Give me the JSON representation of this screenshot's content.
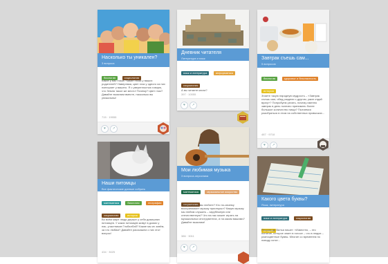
{
  "cards": [
    {
      "title": "Насколько ты уникален?",
      "subtitle": "3 вопроса",
      "tags": [
        {
          "label": "биология",
          "color": "#5aa343"
        },
        {
          "label": "социология",
          "color": "#7a4a1e"
        }
      ],
      "body": "Какие у вас глаза? Какие глаза у ваших родителей? Наверняка, цвет глаз у одного из них повторяет у вашего. Я с уверенностью говорю, что Земля такое же место! Почему? Цвет глаз? Давайте выясним вместе, насколько вы уникальны!",
      "meta": "715 · 19955"
    },
    {
      "title": "Дневник читателя",
      "subtitle": "Литература и язык",
      "tags": [
        {
          "label": "язык и литература",
          "color": "#2f6f7a"
        },
        {
          "label": "информатика",
          "color": "#e3a23a"
        },
        {
          "label": "социология",
          "color": "#7a4a1e"
        }
      ],
      "body": "А вы читаете книги?",
      "meta": "397 · 10055"
    },
    {
      "title": "Завтрак съешь сам...",
      "subtitle": "5 вопросов",
      "tags": [
        {
          "label": "биология",
          "color": "#5aa343"
        },
        {
          "label": "здоровье и безопасность",
          "color": "#e0832c"
        },
        {
          "label": "история",
          "color": "#e6c21f"
        }
      ],
      "body": "Знаете такую народную мудрость – «Завтрак съешь сам, обед раздели с другом, ужин отдай врагу»? Попробуем узнать, почему именно завтрак в день полезно принимать более большое количество пищи? Пытаемся разобраться в этом на собственных привычках...",
      "meta": "487 · 9718"
    },
    {
      "title": "Наши питомцы",
      "subtitle": "Все фактические данные собрать",
      "tags": [
        {
          "label": "математика",
          "color": "#2f9a9a"
        },
        {
          "label": "биология",
          "color": "#5aa343"
        },
        {
          "label": "география",
          "color": "#e0832c"
        },
        {
          "label": "социология",
          "color": "#7a4a1e"
        },
        {
          "label": "история",
          "color": "#e6c21f"
        }
      ],
      "body": "Во всём мире люди держат у себя домашних питомцев. У каких питомцев живут в домах у нас, участников ГлобалЛаб? Какие мы их зовём, за что любим? Давайте расскажем о них этот вопрос!",
      "meta": "434 · 3025"
    },
    {
      "title": "Мои любимая музыка",
      "subtitle": "3 вопроса-опросника",
      "tags": [
        {
          "label": "математика",
          "color": "#1f6b4a"
        },
        {
          "label": "музыкальное искусство",
          "color": "#e0a26a"
        },
        {
          "label": "социология",
          "color": "#7a4a1e"
        }
      ],
      "body": "Какую музыку вы любите? Кто по-своему воспринимает музыку приоткрыл? Какую музыку мы любим слушать – зарубежную или отечественную? Что на нас может играть на музыкальных инструментах, и на каком вашими? Давайте выясним!",
      "meta": "386 · 3011"
    },
    {
      "title": "Какого цвета буквы?",
      "subtitle": "Язык, литература",
      "tags": [
        {
          "label": "язык и литература",
          "color": "#2f6f7a"
        },
        {
          "label": "социология",
          "color": "#7a4a1e"
        },
        {
          "label": "история",
          "color": "#e6c21f"
        }
      ],
      "body": "Рассказ де Вилья пишет: «Известно, – это понятие, которое знает в голосе – что в людях – разноцветные буквы. Многие со временем по поводу хотят...",
      "meta": ""
    }
  ],
  "icons": {
    "like": "heart-icon",
    "share": "share-icon",
    "badge_colors": [
      "#c9562f",
      "#d9b53a",
      "#5c4f47"
    ]
  }
}
